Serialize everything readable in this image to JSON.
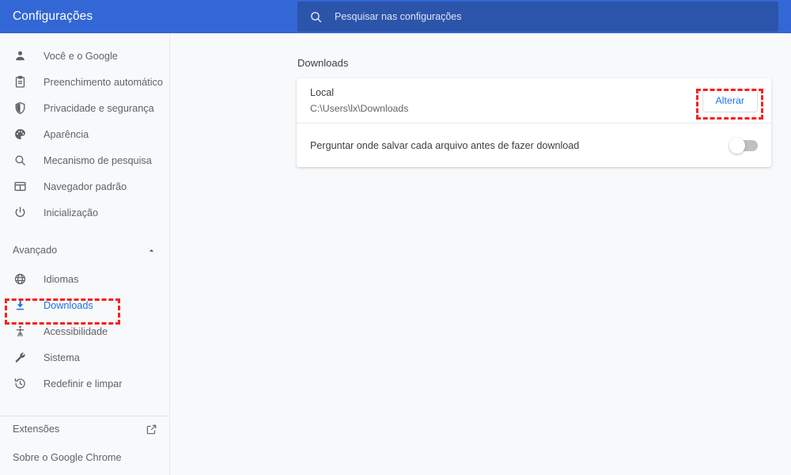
{
  "header": {
    "title": "Configurações",
    "search": {
      "icon": "search-icon",
      "placeholder": "Pesquisar nas configurações",
      "value": ""
    },
    "bg_color": "#3367d6",
    "search_bg_color": "#2b55ab"
  },
  "sidebar": {
    "items": [
      {
        "label": "Você e o Google",
        "icon": "person-icon"
      },
      {
        "label": "Preenchimento automático",
        "icon": "clipboard-icon"
      },
      {
        "label": "Privacidade e segurança",
        "icon": "shield-icon"
      },
      {
        "label": "Aparência",
        "icon": "palette-icon"
      },
      {
        "label": "Mecanismo de pesquisa",
        "icon": "magnifier-icon"
      },
      {
        "label": "Navegador padrão",
        "icon": "browser-window-icon"
      },
      {
        "label": "Inicialização",
        "icon": "power-icon"
      }
    ],
    "advanced": {
      "label": "Avançado",
      "icon": "chevron-up-icon",
      "expanded": true,
      "items": [
        {
          "label": "Idiomas",
          "icon": "globe-icon",
          "active": false
        },
        {
          "label": "Downloads",
          "icon": "download-icon",
          "active": true
        },
        {
          "label": "Acessibilidade",
          "icon": "accessibility-icon",
          "active": false
        },
        {
          "label": "Sistema",
          "icon": "wrench-icon",
          "active": false
        },
        {
          "label": "Redefinir e limpar",
          "icon": "history-restore-icon",
          "active": false
        }
      ]
    },
    "bottom": [
      {
        "label": "Extensões",
        "icon": "external-link-icon"
      },
      {
        "label": "Sobre o Google Chrome",
        "icon": ""
      }
    ],
    "active_color": "#1a73e8",
    "text_color": "#5f6368"
  },
  "main": {
    "section_title": "Downloads",
    "rows": [
      {
        "label": "Local",
        "value": "C:\\Users\\lx\\Downloads",
        "action_label": "Alterar"
      },
      {
        "label": "Perguntar onde salvar cada arquivo antes de fazer download",
        "toggle_state": "off"
      }
    ]
  },
  "annotations": {
    "color": "#f81f1f",
    "style": "dashed-rectangle",
    "targets": [
      "sidebar-item-downloads",
      "change-location-button"
    ]
  }
}
